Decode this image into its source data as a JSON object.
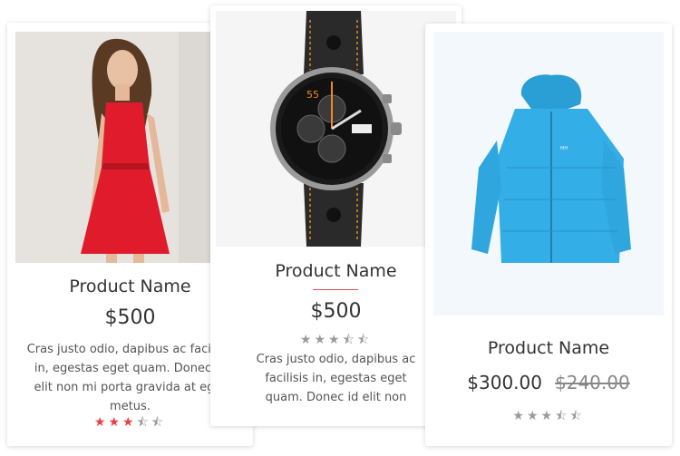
{
  "cards": [
    {
      "title": "Product Name",
      "price": "$500",
      "description": "Cras justo odio, dapibus ac facilisis in, egestas eget quam. Donec id elit non mi porta gravida at eget metus.",
      "rating": 3.5,
      "image": "red-dress-model-image",
      "star_color": "#e8403f"
    },
    {
      "title": "Product Name",
      "price": "$500",
      "description": "Cras justo odio, dapibus ac facilisis in, egestas eget quam. Donec id elit non",
      "rating": 3.5,
      "image": "wristwatch-image",
      "star_color": "#9a9a9a",
      "accent_color": "#d9534f"
    },
    {
      "title": "Product Name",
      "price": "$300.00",
      "old_price": "$240.00",
      "rating": 3.5,
      "image": "blue-jacket-image",
      "star_color": "#9a9a9a"
    }
  ]
}
